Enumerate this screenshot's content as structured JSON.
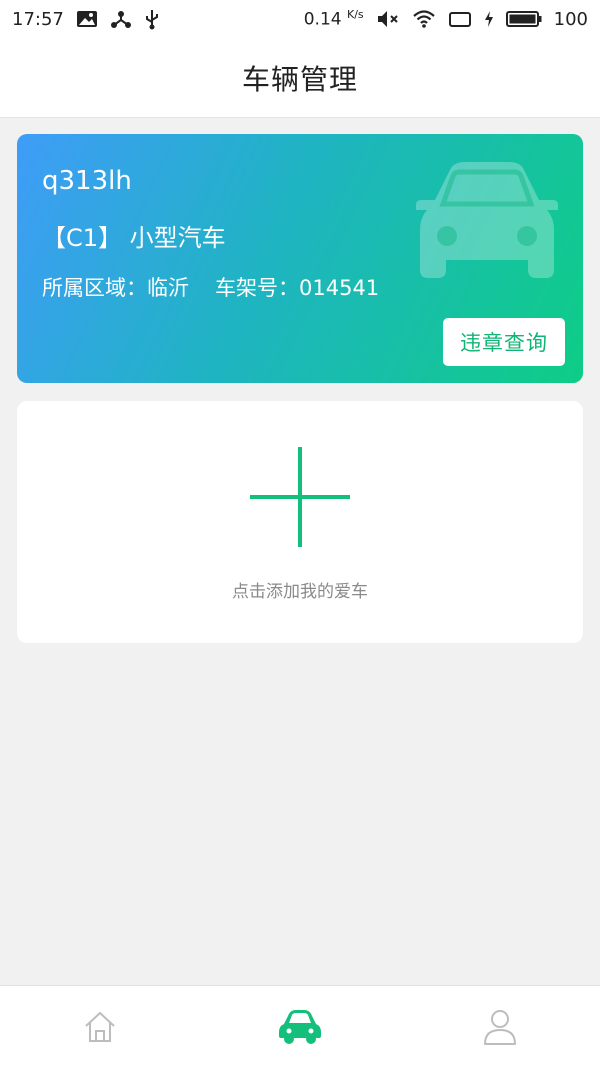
{
  "status_bar": {
    "time": "17:57",
    "net_speed": "0.14",
    "net_unit": "K/s",
    "battery": "100"
  },
  "header": {
    "title": "车辆管理"
  },
  "vehicle": {
    "plate": "q313lh",
    "license_type": "【C1】 小型汽车",
    "region": "所属区域：临沂",
    "vin": "车架号：014541",
    "violation_button": "违章查询"
  },
  "add_vehicle": {
    "label": "点击添加我的爱车"
  },
  "bottom_nav": {
    "items": [
      {
        "icon": "home-icon",
        "active": false
      },
      {
        "icon": "car-icon",
        "active": true
      },
      {
        "icon": "user-icon",
        "active": false
      }
    ]
  },
  "colors": {
    "accent": "#13c07b",
    "gradient_start": "#3f9cf8",
    "gradient_end": "#0ecd86",
    "inactive_icon": "#bdbdbd"
  }
}
